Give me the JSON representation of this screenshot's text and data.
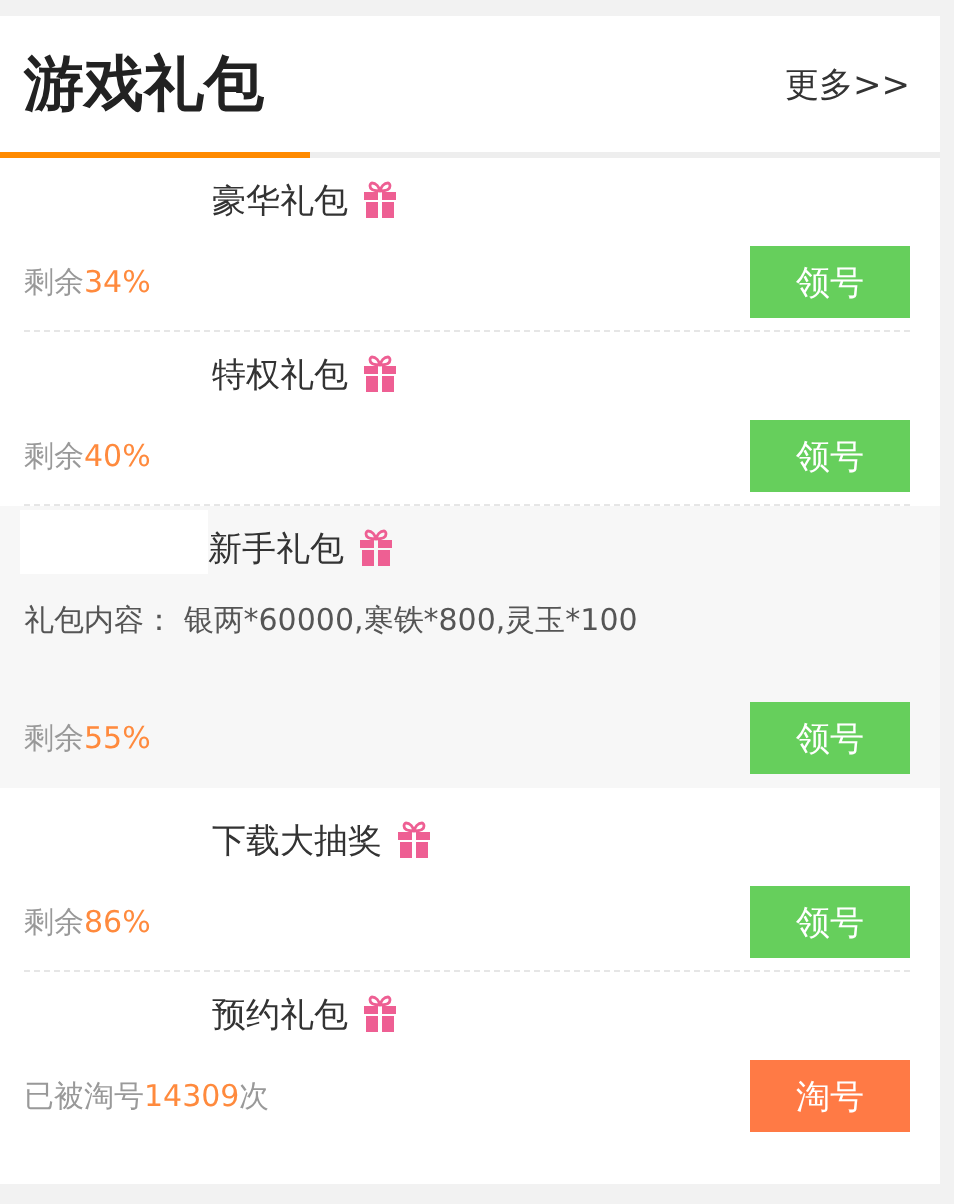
{
  "header": {
    "title": "游戏礼包",
    "more_link": "更多>>"
  },
  "gifts": [
    {
      "name": "豪华礼包",
      "kind": "remaining",
      "expanded": false,
      "status_label": "剩余",
      "status_value": "34%",
      "button": "领号"
    },
    {
      "name": "特权礼包",
      "kind": "remaining",
      "expanded": false,
      "status_label": "剩余",
      "status_value": "40%",
      "button": "领号"
    },
    {
      "name": "新手礼包",
      "kind": "remaining",
      "expanded": true,
      "contents": "礼包内容： 银两*60000,寒铁*800,灵玉*100",
      "status_label": "剩余",
      "status_value": "55%",
      "button": "领号"
    },
    {
      "name": "下载大抽奖",
      "kind": "remaining",
      "expanded": false,
      "status_label": "剩余",
      "status_value": "86%",
      "button": "领号"
    },
    {
      "name": "预约礼包",
      "kind": "taken",
      "expanded": false,
      "status_label": "已被淘号",
      "status_value": "14309",
      "status_suffix": "次",
      "button": "淘号"
    }
  ]
}
